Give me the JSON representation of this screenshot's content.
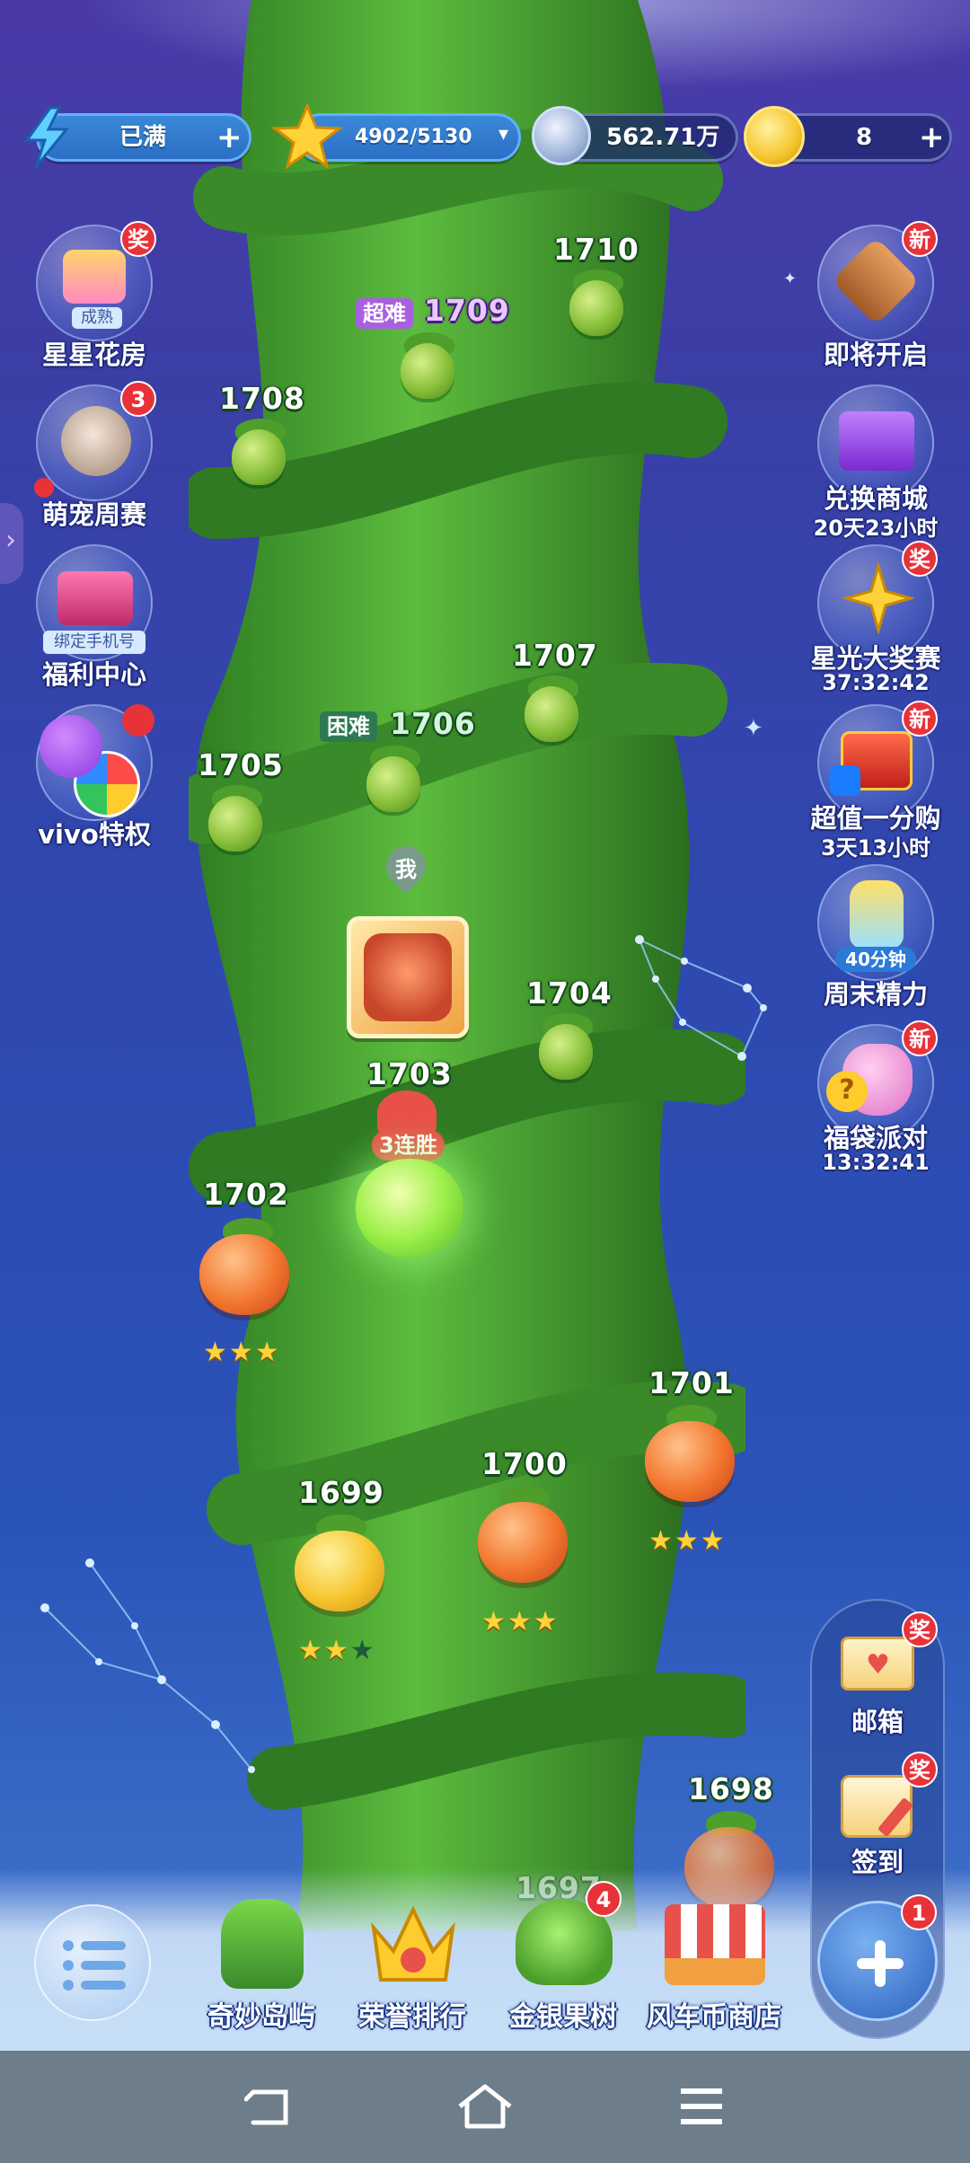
{
  "resources": {
    "energy": {
      "value": "已满",
      "icon": "lightning-icon"
    },
    "stars": {
      "value": "4902/5130",
      "icon": "star-icon"
    },
    "coins": {
      "value": "562.71万",
      "icon": "silver-coin-icon"
    },
    "gold": {
      "value": "8",
      "icon": "gold-coin-icon"
    }
  },
  "left_menu": [
    {
      "label": "星星花房",
      "overlay": "成熟",
      "badge": "奖"
    },
    {
      "label": "萌宠周赛",
      "badge": "3"
    },
    {
      "label": "福利中心",
      "overlay": "绑定手机号"
    },
    {
      "label": "vivo特权"
    }
  ],
  "right_menu": [
    {
      "label": "即将开启",
      "badge": "新"
    },
    {
      "label": "兑换商城",
      "sub": "20天23小时"
    },
    {
      "label": "星光大奖赛",
      "sub": "37:32:42",
      "badge": "奖"
    },
    {
      "label": "超值一分购",
      "sub": "3天13小时",
      "badge": "新"
    },
    {
      "label": "周末精力",
      "overlay": "40分钟"
    },
    {
      "label": "福袋派对",
      "sub": "13:32:41",
      "badge": "新"
    }
  ],
  "levels": [
    {
      "num": "1710"
    },
    {
      "num": "1709",
      "tag": "超难"
    },
    {
      "num": "1708"
    },
    {
      "num": "1707"
    },
    {
      "num": "1706",
      "tag": "困难"
    },
    {
      "num": "1705"
    },
    {
      "num": "1704"
    },
    {
      "num": "1703",
      "streak": "3连胜",
      "player_marker": "我"
    },
    {
      "num": "1702",
      "stars": "★★★"
    },
    {
      "num": "1701",
      "stars": "★★★"
    },
    {
      "num": "1700",
      "stars": "★★★"
    },
    {
      "num": "1699",
      "stars": "★★",
      "empty_star": "★"
    },
    {
      "num": "1698"
    },
    {
      "num": "1697"
    }
  ],
  "bottom_nav": [
    {
      "label": "奇妙岛屿"
    },
    {
      "label": "荣誉排行"
    },
    {
      "label": "金银果树",
      "badge": "4"
    },
    {
      "label": "风车币商店"
    }
  ],
  "right_panel": [
    {
      "label": "邮箱",
      "badge": "奖"
    },
    {
      "label": "签到",
      "badge": "奖"
    },
    {
      "label": "",
      "badge": "1"
    }
  ],
  "colors": {
    "badge": "#e8323a",
    "stalk": "#3f9a2e",
    "sky": "#2e49b0"
  }
}
